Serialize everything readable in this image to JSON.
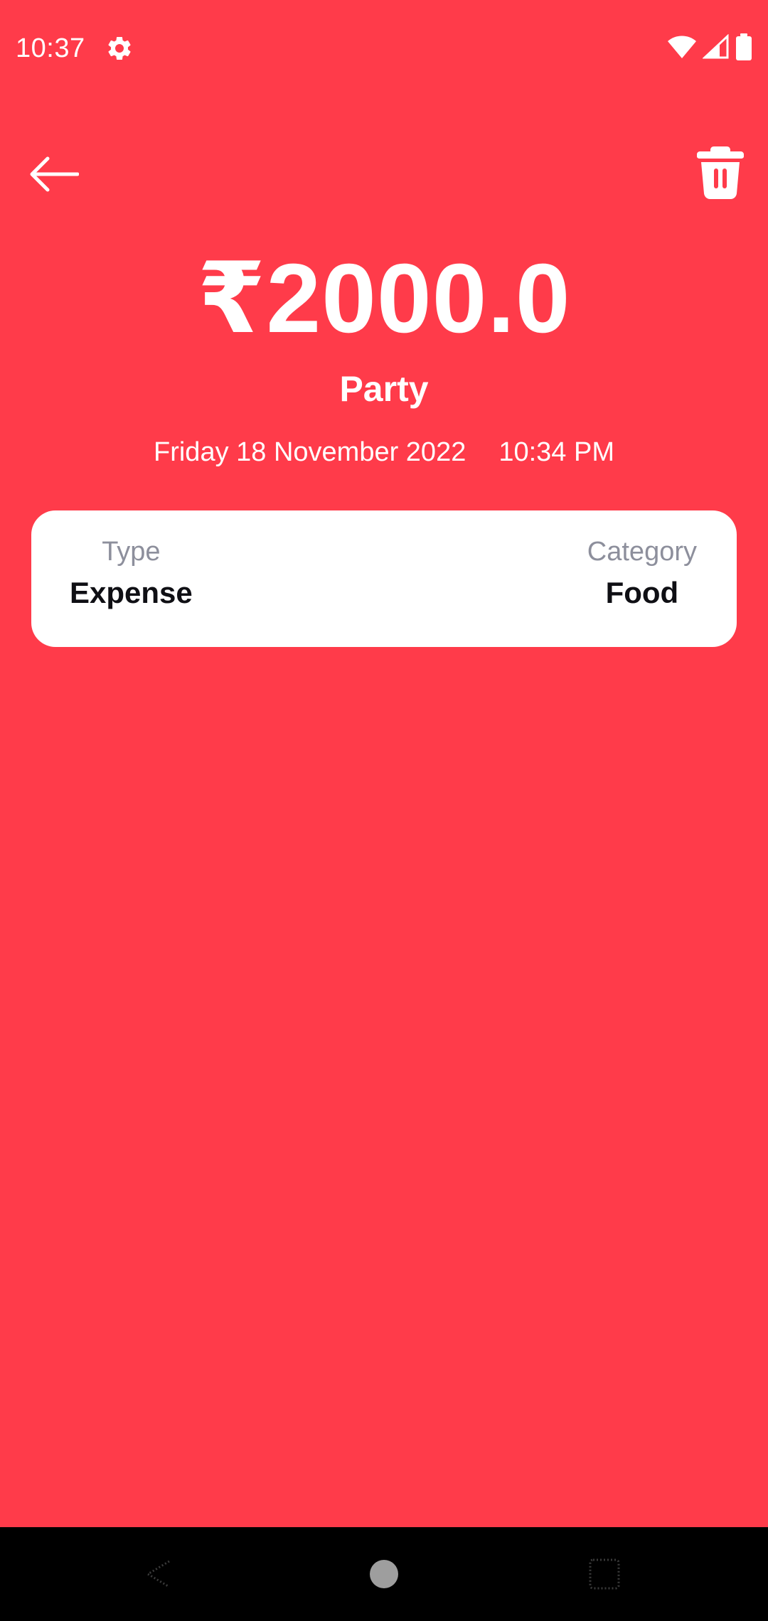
{
  "status_bar": {
    "time": "10:37",
    "icons": [
      "settings-gear-icon",
      "wifi-icon",
      "cell-signal-icon",
      "battery-icon"
    ]
  },
  "app_bar": {
    "back_icon": "arrow-left-icon",
    "delete_icon": "trash-icon"
  },
  "transaction": {
    "amount": "₹2000.0",
    "title": "Party",
    "date": "Friday 18 November 2022",
    "time": "10:34 PM",
    "type_label": "Type",
    "type_value": "Expense",
    "category_label": "Category",
    "category_value": "Food"
  },
  "nav_bar": {
    "icons": [
      "nav-back-icon",
      "nav-home-icon",
      "nav-recents-icon"
    ]
  },
  "colors": {
    "background": "#ff3b4a",
    "card": "#ffffff",
    "label": "#8d8f9c",
    "value": "#0f0f14"
  }
}
